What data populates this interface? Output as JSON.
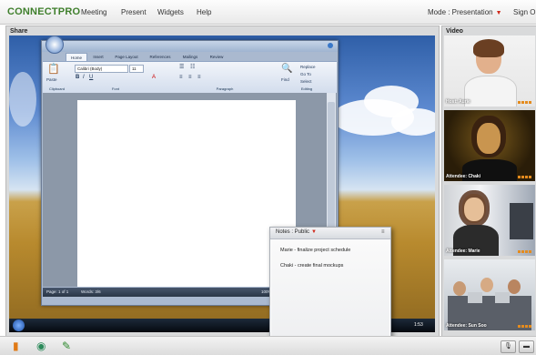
{
  "app": {
    "logo": "CONNECTPRO"
  },
  "menu": {
    "items": [
      "Meeting",
      "Present",
      "Widgets",
      "Help"
    ]
  },
  "header_right": {
    "mode_label": "Mode : Presentation",
    "signout_label": "Sign Out"
  },
  "share_pod": {
    "title": "Share"
  },
  "video_pod": {
    "title": "Video",
    "feeds": [
      {
        "label": "Host: Aurie"
      },
      {
        "label": "Attendee: Chaki"
      },
      {
        "label": "Attendee: Marie"
      },
      {
        "label": "Attendee: Sun Soo"
      }
    ]
  },
  "word": {
    "tabs": [
      "Home",
      "Insert",
      "Page Layout",
      "References",
      "Mailings",
      "Review"
    ],
    "font_name": "Calibri (Body)",
    "font_size": "11",
    "groups": [
      "Clipboard",
      "Font",
      "Paragraph",
      "Editing"
    ],
    "editing": {
      "find": "Find",
      "replace": "Replace",
      "goto": "Go To",
      "select": "Select"
    },
    "paste_label": "Paste",
    "status_page": "Page: 1 of 1",
    "status_words": "Words: 3/6",
    "zoom": "100%"
  },
  "taskbar": {
    "clock": "1:53"
  },
  "notes": {
    "title": "Notes : Public",
    "lines": [
      "Marie - finalize project schedule",
      "Chaki - create final mockups"
    ]
  },
  "colors": {
    "brand": "#3f7f2c",
    "accent": "#d02a1c"
  }
}
